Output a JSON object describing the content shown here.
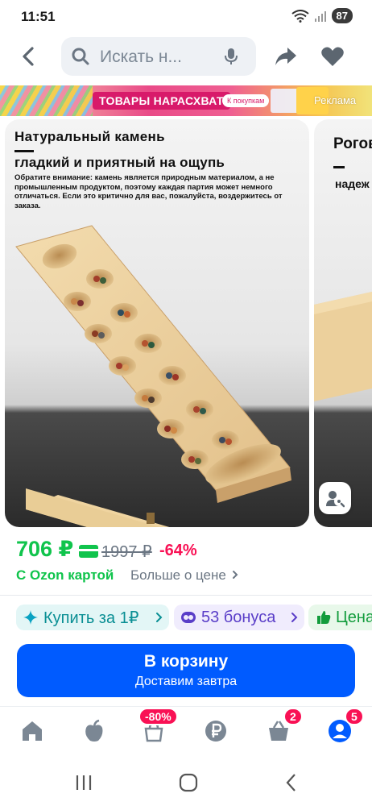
{
  "status": {
    "time": "11:51",
    "battery": "87"
  },
  "search": {
    "placeholder": "Искать н..."
  },
  "banner": {
    "title": "ТОВАРЫ НАРАСХВАТ",
    "pill": "К покупкам",
    "ad_label": "Реклама"
  },
  "gallery": {
    "slide1": {
      "title": "Натуральный камень",
      "subtitle": "гладкий и приятный на ощупь",
      "note": "Обратите внимание: камень является природным материалом, а не промышленным продуктом, поэтому каждая партия может немного отличаться. Если это критично для вас, пожалуйста, воздержитесь от заказа."
    },
    "slide2": {
      "title": "Рогов",
      "subtitle": "надеж"
    }
  },
  "price": {
    "current": "706 ₽",
    "old": "1997 ₽",
    "discount": "-64%",
    "ozon_card": "С Ozon картой",
    "more": "Больше о цене"
  },
  "chips": [
    {
      "label": "Купить за 1₽",
      "icon": "sparkle-icon"
    },
    {
      "label": "53 бонуса",
      "icon": "bonus-icon"
    },
    {
      "label": "Цена",
      "icon": "thumbs-up-icon"
    }
  ],
  "cart": {
    "title": "В корзину",
    "subtitle": "Доставим завтра"
  },
  "bottom_nav": {
    "badges": {
      "sale": "-80%",
      "cart": "2",
      "profile": "5"
    }
  },
  "colors": {
    "accent": "#005bff",
    "price_green": "#10c44c",
    "discount_red": "#f91155"
  }
}
